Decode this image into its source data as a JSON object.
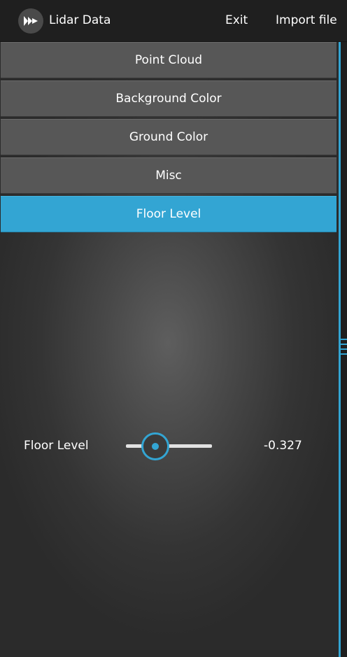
{
  "app": {
    "title": "Lidar Data",
    "logo_icon": "kivy-logo-icon"
  },
  "menu": {
    "exit_label": "Exit",
    "import_label": "Import file"
  },
  "panels": [
    {
      "label": "Point Cloud",
      "active": false
    },
    {
      "label": "Background Color",
      "active": false
    },
    {
      "label": "Ground Color",
      "active": false
    },
    {
      "label": "Misc",
      "active": false
    },
    {
      "label": "Floor Level",
      "active": true
    }
  ],
  "floor_level": {
    "label": "Floor Level",
    "value_text": "-0.327",
    "slider_fraction": 0.33
  },
  "colors": {
    "accent": "#33a5d3",
    "button_bg": "#575757",
    "topbar_bg": "#1f1f1f"
  }
}
